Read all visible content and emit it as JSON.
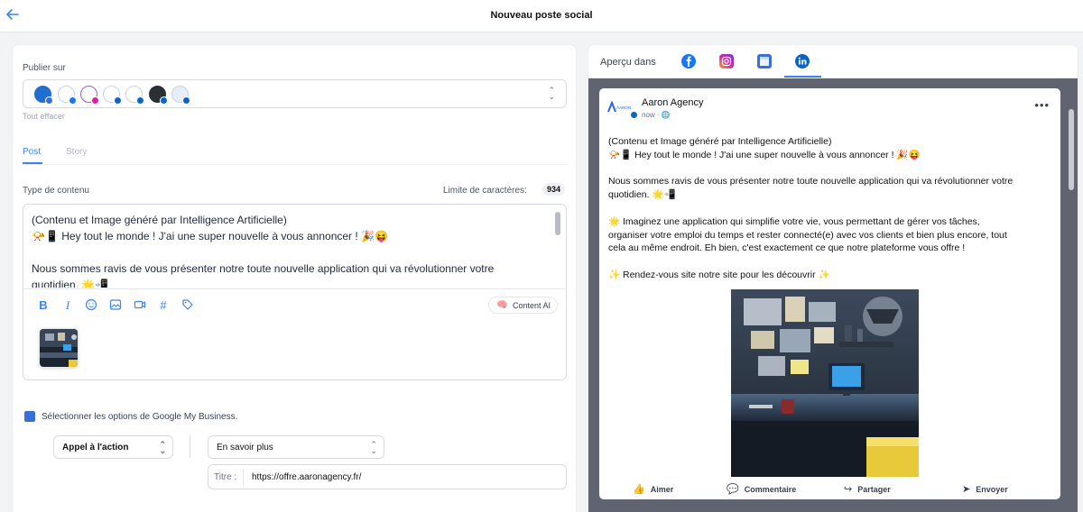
{
  "header": {
    "title": "Nouveau poste social",
    "back_icon": "arrow-left-icon"
  },
  "publish": {
    "label": "Publier sur",
    "clear_label": "Tout effacer",
    "accounts": [
      {
        "name": "account-1",
        "network": "google-my-business",
        "color": "#1f6fd1"
      },
      {
        "name": "account-2",
        "network": "facebook",
        "color": "#1877f2"
      },
      {
        "name": "account-3",
        "network": "instagram",
        "color": "#d6249f"
      },
      {
        "name": "account-4",
        "network": "linkedin",
        "color": "#0a66c2"
      },
      {
        "name": "account-5",
        "network": "linkedin",
        "color": "#0a66c2"
      },
      {
        "name": "account-6",
        "network": "linkedin",
        "color": "#0a66c2"
      },
      {
        "name": "account-7",
        "network": "linkedin",
        "color": "#0a66c2"
      }
    ]
  },
  "tabs": {
    "post": "Post",
    "story": "Story"
  },
  "content": {
    "type_label": "Type de contenu",
    "limit_label": "Limite de caractères:",
    "limit_value": "934",
    "lines": [
      "(Contenu et Image généré par Intelligence Artificielle)",
      "📯📱 Hey tout le monde ! J'ai une super nouvelle à vous annoncer ! 🎉😝",
      "",
      "Nous sommes ravis de vous présenter notre toute nouvelle application qui va révolutionner votre",
      "quotidien. 🌟📲"
    ],
    "content_ai_label": "Content AI"
  },
  "gmb": {
    "label": "Sélectionner les options de Google My Business.",
    "action_select": "Appel à l'action",
    "value_select": "En savoir plus",
    "url_prefix": "Titre :",
    "url_value": "https://offre.aaronagency.fr/"
  },
  "preview": {
    "label": "Aperçu dans",
    "author": "Aaron Agency",
    "logo_text": "AARON",
    "meta": "now · 🌐",
    "more": "•••",
    "lines": [
      "(Contenu et Image généré par Intelligence Artificielle)",
      "📯📱 Hey tout le monde ! J'ai une super nouvelle à vous annoncer ! 🎉😝",
      "",
      "Nous sommes ravis de vous présenter notre toute nouvelle application qui va révolutionner votre",
      "quotidien. 🌟📲",
      "",
      "🌟 Imaginez une application qui simplifie votre vie, vous permettant de gérer vos tâches,",
      "organiser votre emploi du temps et rester connecté(e) avec vos clients et bien plus encore, tout",
      "cela au même endroit. Eh bien, c'est exactement ce que notre plateforme vous offre !",
      "",
      "✨ Rendez-vous site notre site pour les découvrir ✨"
    ],
    "actions": {
      "like": "Aimer",
      "comment": "Commentaire",
      "share": "Partager",
      "send": "Envoyer"
    }
  },
  "colors": {
    "accent": "#3b82f6",
    "linkedin": "#0a66c2",
    "facebook": "#1877f2",
    "instagram": "#d6249f",
    "gmb": "#3b6fd8"
  }
}
